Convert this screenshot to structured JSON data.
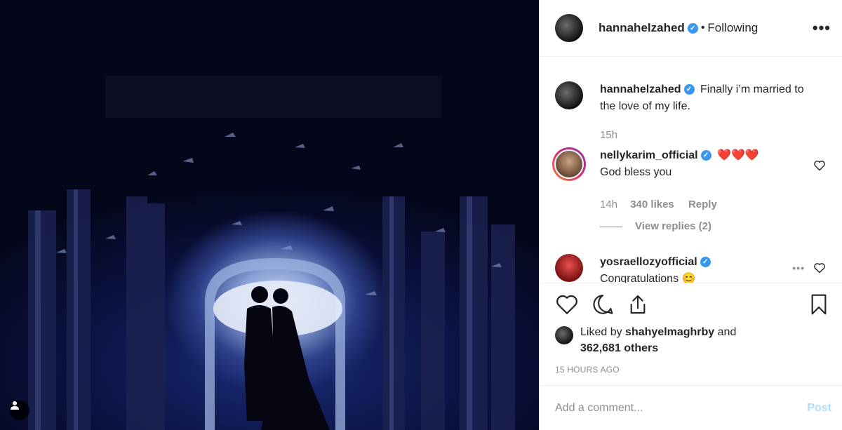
{
  "post": {
    "author": "hannahelzahed",
    "follow_dot": "•",
    "follow_status": "Following",
    "more_icon": "•••",
    "caption": "Finally i’m married to the love of my life.",
    "caption_time": "15h"
  },
  "comments": [
    {
      "user": "nellykarim_official",
      "emoji": "❤️❤️❤️",
      "text": "God bless you",
      "time": "14h",
      "likes": "340 likes",
      "reply": "Reply",
      "view_replies": "View replies (2)"
    },
    {
      "user": "yosraellozyofficial",
      "text": "Congratulations 😊"
    }
  ],
  "likes": {
    "prefix": "Liked by",
    "user": "shahyelmaghrby",
    "conj": "and",
    "others": "362,681 others"
  },
  "timestamp": "15 HOURS AGO",
  "comment_box": {
    "placeholder": "Add a comment...",
    "post_label": "Post"
  },
  "colors": {
    "verified": "#3897f0",
    "heart_red": "#ed4956",
    "post_disabled": "#b3dbff",
    "muted": "#8e8e8e"
  },
  "icons": [
    "verified-badge-icon",
    "more-options-icon",
    "like-heart-icon",
    "comment-icon",
    "share-icon",
    "bookmark-icon",
    "user-tag-icon"
  ]
}
